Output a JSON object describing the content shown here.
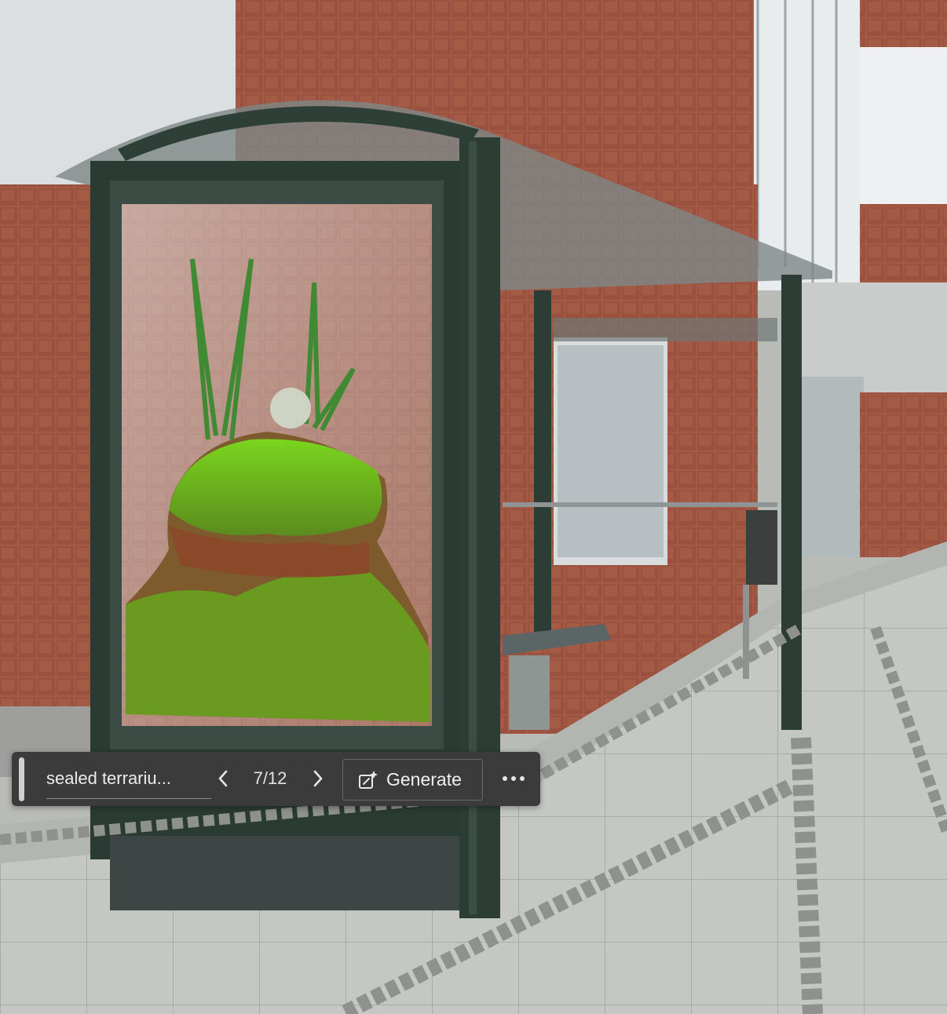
{
  "canvas": {
    "description_icon": "photo-canvas"
  },
  "toolbar": {
    "prompt_text": "sealed terrariu...",
    "counter": "7/12",
    "generate_label": "Generate",
    "prev_icon": "chevron-left-icon",
    "next_icon": "chevron-right-icon",
    "generate_icon": "sparkle-edit-icon",
    "more_icon": "more-horizontal-icon"
  }
}
